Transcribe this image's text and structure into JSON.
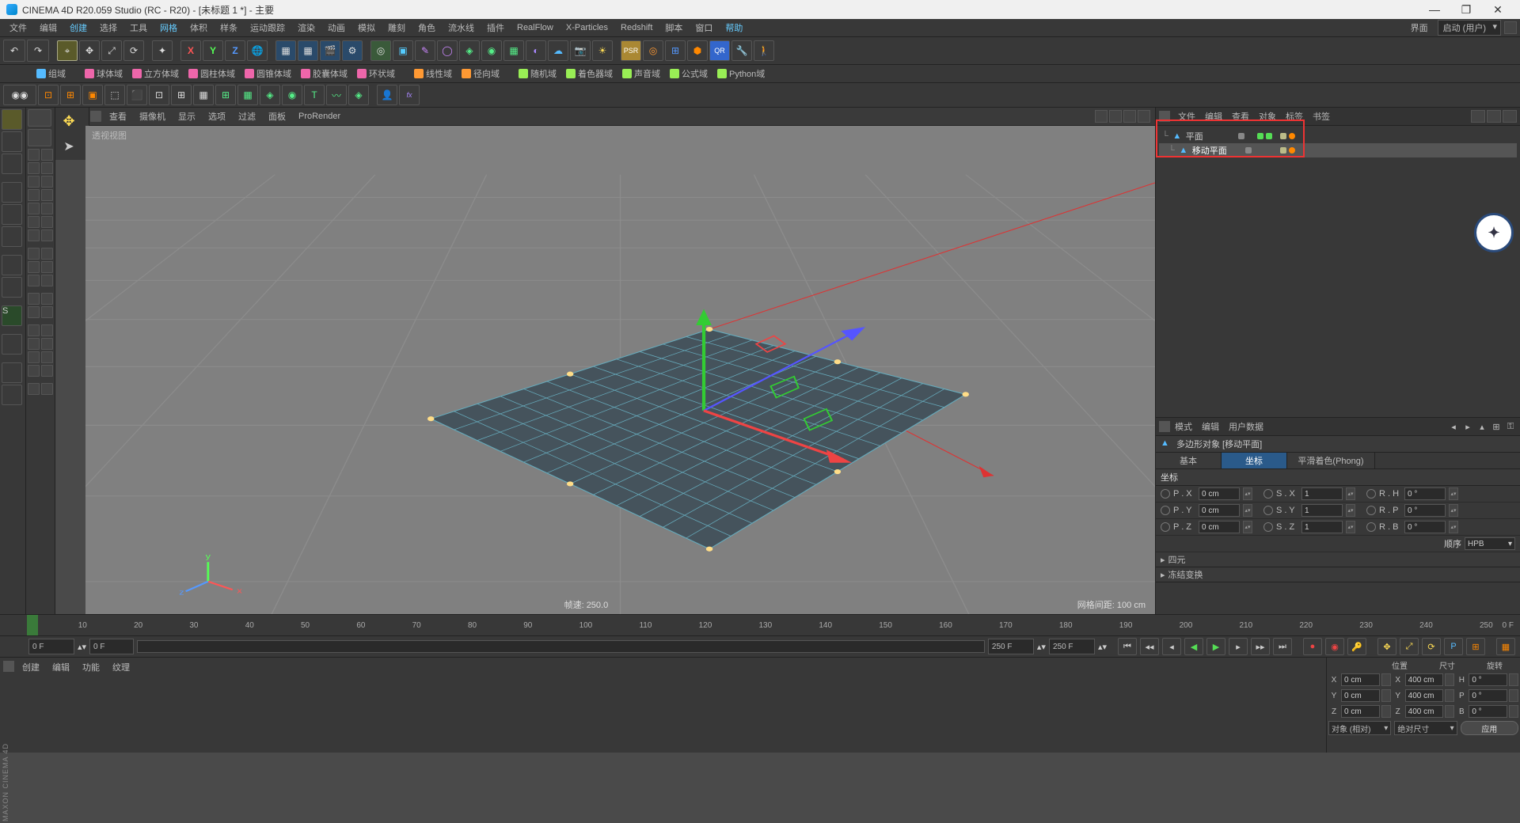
{
  "title": "CINEMA 4D R20.059 Studio (RC - R20) - [未标题 1 *] - 主要",
  "menus": [
    "文件",
    "编辑",
    "创建",
    "选择",
    "工具",
    "网格",
    "体积",
    "样条",
    "运动跟踪",
    "渲染",
    "动画",
    "模拟",
    "雕刻",
    "角色",
    "流水线",
    "插件",
    "RealFlow",
    "X-Particles",
    "Redshift",
    "脚本",
    "窗口",
    "帮助"
  ],
  "menu_hl_indices": [
    2,
    5,
    21
  ],
  "layout": {
    "label": "界面",
    "value": "启动 (用户)"
  },
  "toolbar2": [
    {
      "label": "组域",
      "color": "#5bf"
    },
    {
      "label": "球体域",
      "color": "#e6a"
    },
    {
      "label": "立方体域",
      "color": "#e6a"
    },
    {
      "label": "圆柱体域",
      "color": "#e6a"
    },
    {
      "label": "圆锥体域",
      "color": "#e6a"
    },
    {
      "label": "胶囊体域",
      "color": "#e6a"
    },
    {
      "label": "环状域",
      "color": "#e6a"
    },
    {
      "label": "线性域",
      "color": "#f93"
    },
    {
      "label": "径向域",
      "color": "#f93"
    },
    {
      "label": "随机域",
      "color": "#9e5"
    },
    {
      "label": "着色器域",
      "color": "#9e5"
    },
    {
      "label": "声音域",
      "color": "#9e5"
    },
    {
      "label": "公式域",
      "color": "#9e5"
    },
    {
      "label": "Python域",
      "color": "#9e5"
    }
  ],
  "viewport": {
    "menus": [
      "查看",
      "摄像机",
      "显示",
      "选项",
      "过滤",
      "面板",
      "ProRender"
    ],
    "label": "透视视图",
    "fps_label": "帧速: 250.0",
    "grid_label": "网格间距: 100 cm"
  },
  "om": {
    "menus": [
      "文件",
      "编辑",
      "查看",
      "对象",
      "标签",
      "书签"
    ],
    "rows": [
      {
        "name": "平面",
        "sel": false
      },
      {
        "name": "移动平面",
        "sel": true
      }
    ]
  },
  "attr": {
    "menus": [
      "模式",
      "编辑",
      "用户数据"
    ],
    "title": "多边形对象 [移动平面]",
    "tabs": [
      "基本",
      "坐标",
      "平滑着色(Phong)"
    ],
    "active_tab": 1,
    "section": "坐标",
    "props": [
      [
        {
          "l": "P . X",
          "v": "0 cm"
        },
        {
          "l": "S . X",
          "v": "1"
        },
        {
          "l": "R . H",
          "v": "0 °"
        }
      ],
      [
        {
          "l": "P . Y",
          "v": "0 cm"
        },
        {
          "l": "S . Y",
          "v": "1"
        },
        {
          "l": "R . P",
          "v": "0 °"
        }
      ],
      [
        {
          "l": "P . Z",
          "v": "0 cm"
        },
        {
          "l": "S . Z",
          "v": "1"
        },
        {
          "l": "R . B",
          "v": "0 °"
        }
      ]
    ],
    "order_label": "顺序",
    "order_value": "HPB",
    "collapsed": [
      "四元",
      "冻结变换"
    ]
  },
  "timeline": {
    "start": 0,
    "end": 250,
    "ticks": [
      0,
      10,
      20,
      30,
      40,
      50,
      60,
      70,
      80,
      90,
      100,
      110,
      120,
      130,
      140,
      150,
      160,
      170,
      180,
      190,
      200,
      210,
      220,
      230,
      240,
      250
    ]
  },
  "playback": {
    "f1": "0 F",
    "f2": "0 F",
    "f3": "250 F",
    "f4": "250 F"
  },
  "material_menus": [
    "创建",
    "编辑",
    "功能",
    "纹理"
  ],
  "coords": {
    "headers": [
      "位置",
      "尺寸",
      "旋转"
    ],
    "rows": [
      {
        "a": "X",
        "p": "0 cm",
        "s": "400 cm",
        "rl": "H",
        "r": "0 °"
      },
      {
        "a": "Y",
        "p": "0 cm",
        "s": "400 cm",
        "rl": "P",
        "r": "0 °"
      },
      {
        "a": "Z",
        "p": "0 cm",
        "s": "400 cm",
        "rl": "B",
        "r": "0 °"
      }
    ],
    "sel1": "对象 (相对)",
    "sel2": "绝对尺寸",
    "apply": "应用"
  },
  "maxon": "MAXON CINEMA 4D"
}
